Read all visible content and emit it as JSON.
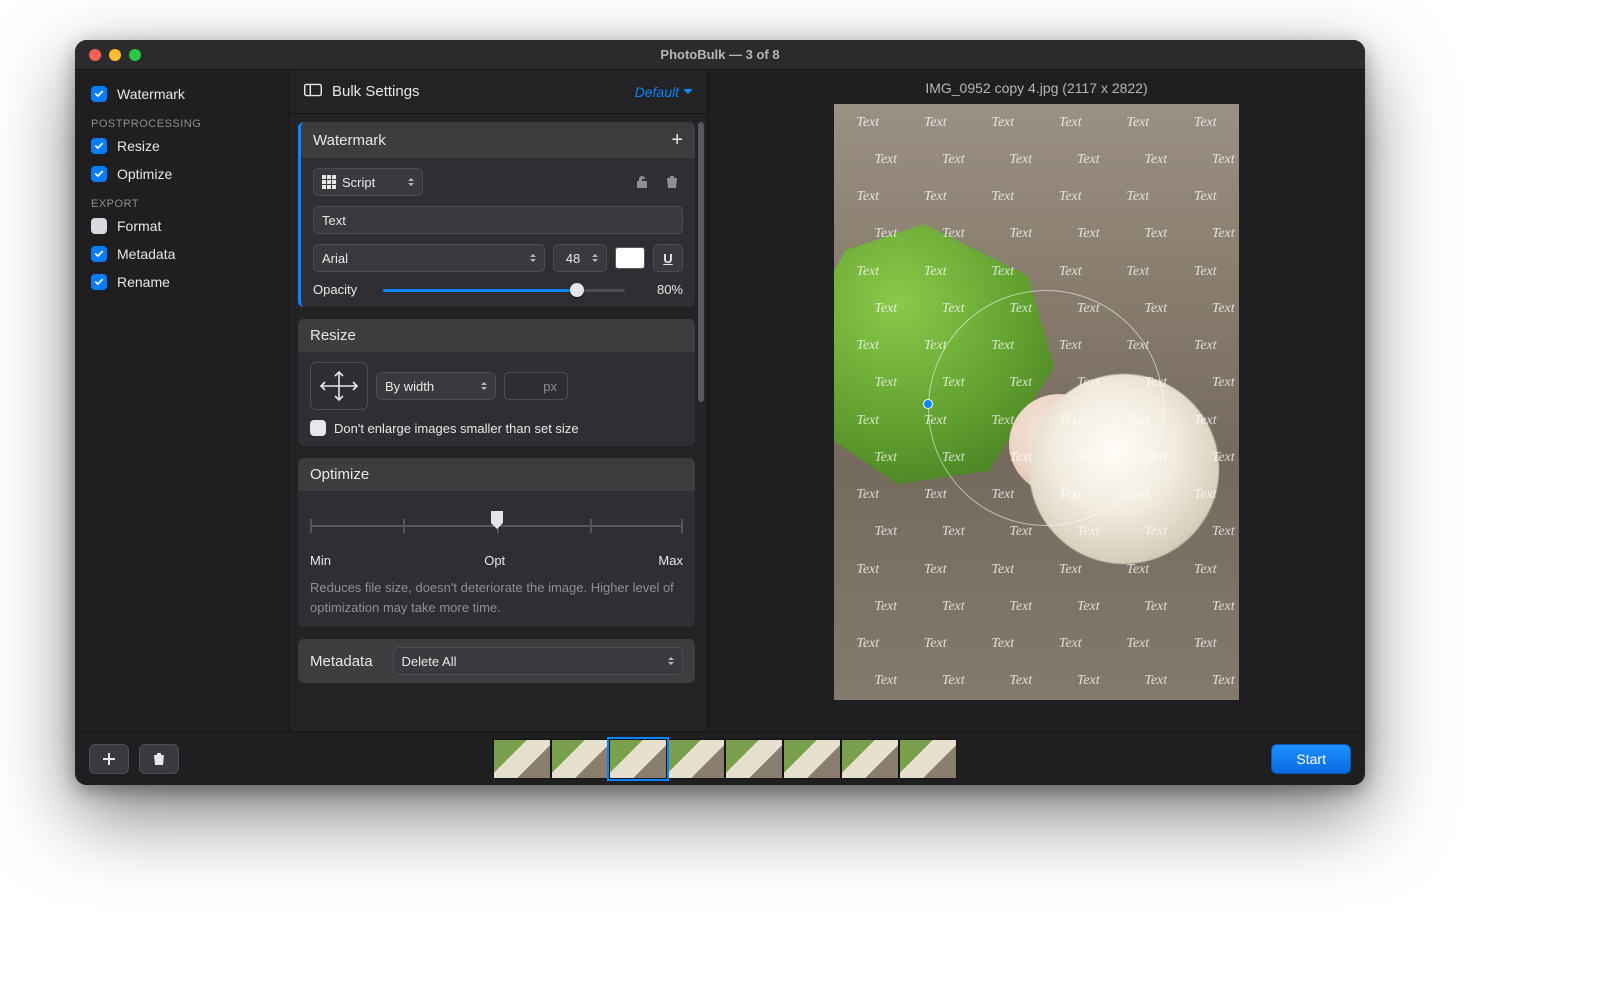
{
  "window": {
    "title": "PhotoBulk — 3 of 8"
  },
  "sidebar": {
    "top": {
      "watermark": "Watermark"
    },
    "groups": {
      "postprocessing": {
        "label": "POSTPROCESSING",
        "items": {
          "resize": "Resize",
          "optimize": "Optimize"
        }
      },
      "export": {
        "label": "EXPORT",
        "items": {
          "format": "Format",
          "metadata": "Metadata",
          "rename": "Rename"
        }
      }
    }
  },
  "settings": {
    "title": "Bulk Settings",
    "preset": "Default",
    "watermark": {
      "header": "Watermark",
      "type": "Script",
      "text_value": "Text",
      "font": "Arial",
      "font_size": "48",
      "opacity_label": "Opacity",
      "opacity_value": "80%",
      "opacity_fraction": 0.8
    },
    "resize": {
      "header": "Resize",
      "mode": "By width",
      "unit": "px",
      "no_enlarge": "Don't enlarge images smaller than set size"
    },
    "optimize": {
      "header": "Optimize",
      "min": "Min",
      "opt": "Opt",
      "max": "Max",
      "note": "Reduces file size, doesn't deteriorate the image. Higher level of optimization may take more time."
    },
    "metadata": {
      "header": "Metadata",
      "action": "Delete All"
    }
  },
  "preview": {
    "filename_info": "IMG_0952 copy 4.jpg (2117 x 2822)",
    "watermark_text": "Text"
  },
  "footer": {
    "start": "Start",
    "thumb_count": 8,
    "selected_index": 2
  }
}
